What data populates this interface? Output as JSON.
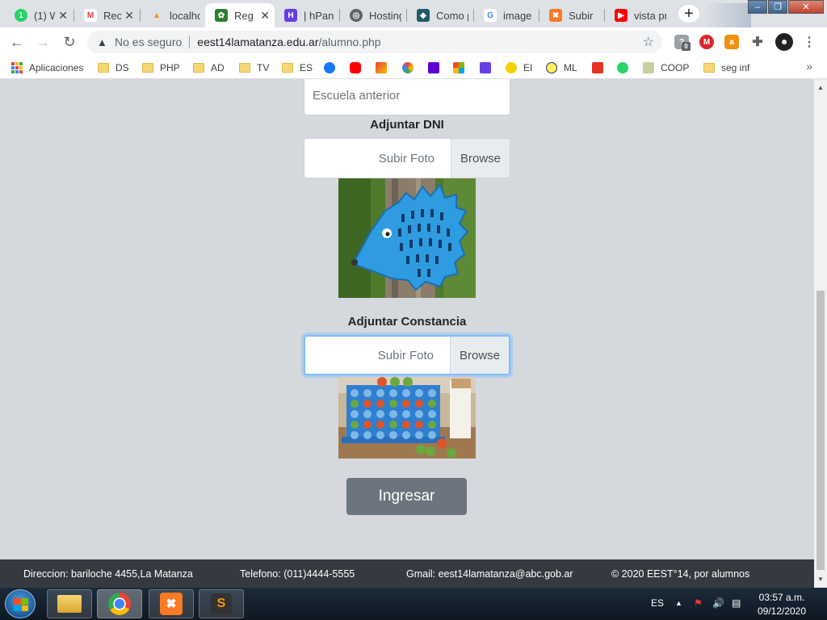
{
  "browser": {
    "tabs": [
      {
        "title": "(1) W",
        "favicon": "whatsapp-icon",
        "color": "#25d366"
      },
      {
        "title": "Rec",
        "favicon": "gmail-icon",
        "color": "#ea4335"
      },
      {
        "title": "localhos",
        "favicon": "phpmyadmin-icon",
        "color": "#f29111"
      },
      {
        "title": "Reg",
        "favicon": "school-site-icon",
        "color": "#2e7d32"
      },
      {
        "title": "| hPanel",
        "favicon": "hostinger-icon",
        "color": "#673de6"
      },
      {
        "title": "Hosting",
        "favicon": "globe-icon",
        "color": "#5f6368"
      },
      {
        "title": "Como p",
        "favicon": "code-icon",
        "color": "#1f5a66"
      },
      {
        "title": "image c",
        "favicon": "google-icon",
        "color": "#4285f4"
      },
      {
        "title": "Subir",
        "favicon": "xampp-icon",
        "color": "#fb7a24"
      },
      {
        "title": "vista pre",
        "favicon": "youtube-icon",
        "color": "#ff0000"
      }
    ],
    "new_tab": "+",
    "window_controls": {
      "minimize": "–",
      "restore": "❐",
      "close": "✕"
    },
    "address": {
      "security_icon": "warning-icon",
      "security_text": "No es seguro",
      "host": "eest14lamatanza.edu.ar",
      "path": "/alumno.php"
    },
    "extension_badge": "0",
    "bookmarks": [
      {
        "label": "Aplicaciones",
        "icon": "apps-icon"
      },
      {
        "label": "DS",
        "icon": "folder-icon"
      },
      {
        "label": "PHP",
        "icon": "folder-icon"
      },
      {
        "label": "AD",
        "icon": "folder-icon"
      },
      {
        "label": "TV",
        "icon": "folder-icon"
      },
      {
        "label": "ES",
        "icon": "folder-icon"
      },
      {
        "label": "",
        "icon": "facebook-icon"
      },
      {
        "label": "",
        "icon": "youtube-icon"
      },
      {
        "label": "",
        "icon": "gmail-icon"
      },
      {
        "label": "",
        "icon": "google-icon"
      },
      {
        "label": "",
        "icon": "yahoo-icon"
      },
      {
        "label": "",
        "icon": "microsoft-icon"
      },
      {
        "label": "",
        "icon": "hostinger-icon"
      },
      {
        "label": "EI",
        "icon": "ei-icon"
      },
      {
        "label": "ML",
        "icon": "mercadolibre-icon"
      },
      {
        "label": "",
        "icon": "aliexpress-icon"
      },
      {
        "label": "",
        "icon": "whatsapp-icon"
      },
      {
        "label": "COOP",
        "icon": "coop-icon"
      },
      {
        "label": "seg inf",
        "icon": "folder-icon"
      }
    ],
    "bookmarks_more": "»"
  },
  "form": {
    "previous_school_placeholder": "Escuela anterior",
    "dni_label": "Adjuntar DNI",
    "dni_file_placeholder": "Subir Foto",
    "dni_browse_label": "Browse",
    "constancia_label": "Adjuntar Constancia",
    "constancia_file_placeholder": "Subir Foto",
    "constancia_browse_label": "Browse",
    "submit_label": "Ingresar"
  },
  "footer": {
    "address": "Direccion: bariloche 4455,La Matanza",
    "phone": "Telefono: (011)4444-5555",
    "email": "Gmail: eest14lamatanza@abc.gob.ar",
    "copyright": "© 2020 EEST°14, por alumnos"
  },
  "taskbar": {
    "language": "ES",
    "time": "03:57 a.m.",
    "date": "09/12/2020"
  }
}
